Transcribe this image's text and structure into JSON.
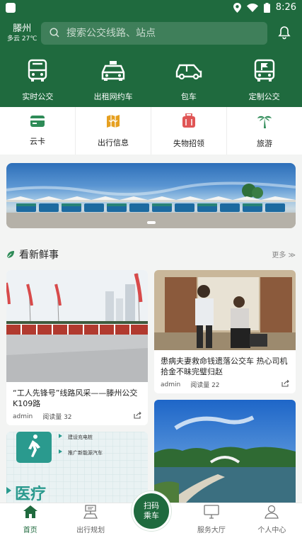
{
  "status": {
    "time": "8:26"
  },
  "header": {
    "city": "滕州",
    "weather": "多云 27℃",
    "search_placeholder": "搜索公交线路、站点"
  },
  "main_services": [
    {
      "label": "实时公交",
      "icon": "bus-icon"
    },
    {
      "label": "出租网约车",
      "icon": "taxi-icon"
    },
    {
      "label": "包车",
      "icon": "car-icon"
    },
    {
      "label": "定制公交",
      "icon": "custom-bus-icon"
    }
  ],
  "sub_services": [
    {
      "label": "云卡",
      "icon": "card-icon",
      "color": "#2e8b57"
    },
    {
      "label": "出行信息",
      "icon": "map-icon",
      "color": "#e6a020"
    },
    {
      "label": "失物招领",
      "icon": "luggage-icon",
      "color": "#e05555"
    },
    {
      "label": "旅游",
      "icon": "palm-tree-icon",
      "color": "#2e8b57"
    }
  ],
  "news_section": {
    "title": "看新鲜事",
    "more": "更多 ≫"
  },
  "news": [
    {
      "title": "“工人先锋号”线路风采——滕州公交K109路",
      "author": "admin",
      "reads": "阅读量 32"
    },
    {
      "title": "患病夫妻救命钱遗落公交车 热心司机拾金不昧完璧归赵",
      "author": "admin",
      "reads": "阅读量 22"
    }
  ],
  "promo_card": {
    "items": [
      "建设充电桩",
      "推广新能源汽车"
    ],
    "heading": "医疗"
  },
  "bottom_nav": [
    {
      "label": "首页",
      "icon": "home-icon"
    },
    {
      "label": "出行规划",
      "icon": "route-icon"
    },
    {
      "label": "",
      "icon": ""
    },
    {
      "label": "服务大厅",
      "icon": "monitor-icon"
    },
    {
      "label": "个人中心",
      "icon": "user-icon"
    }
  ],
  "scan_button": {
    "line1": "扫码",
    "line2": "乘车"
  },
  "colors": {
    "brand": "#1f6a3e"
  }
}
